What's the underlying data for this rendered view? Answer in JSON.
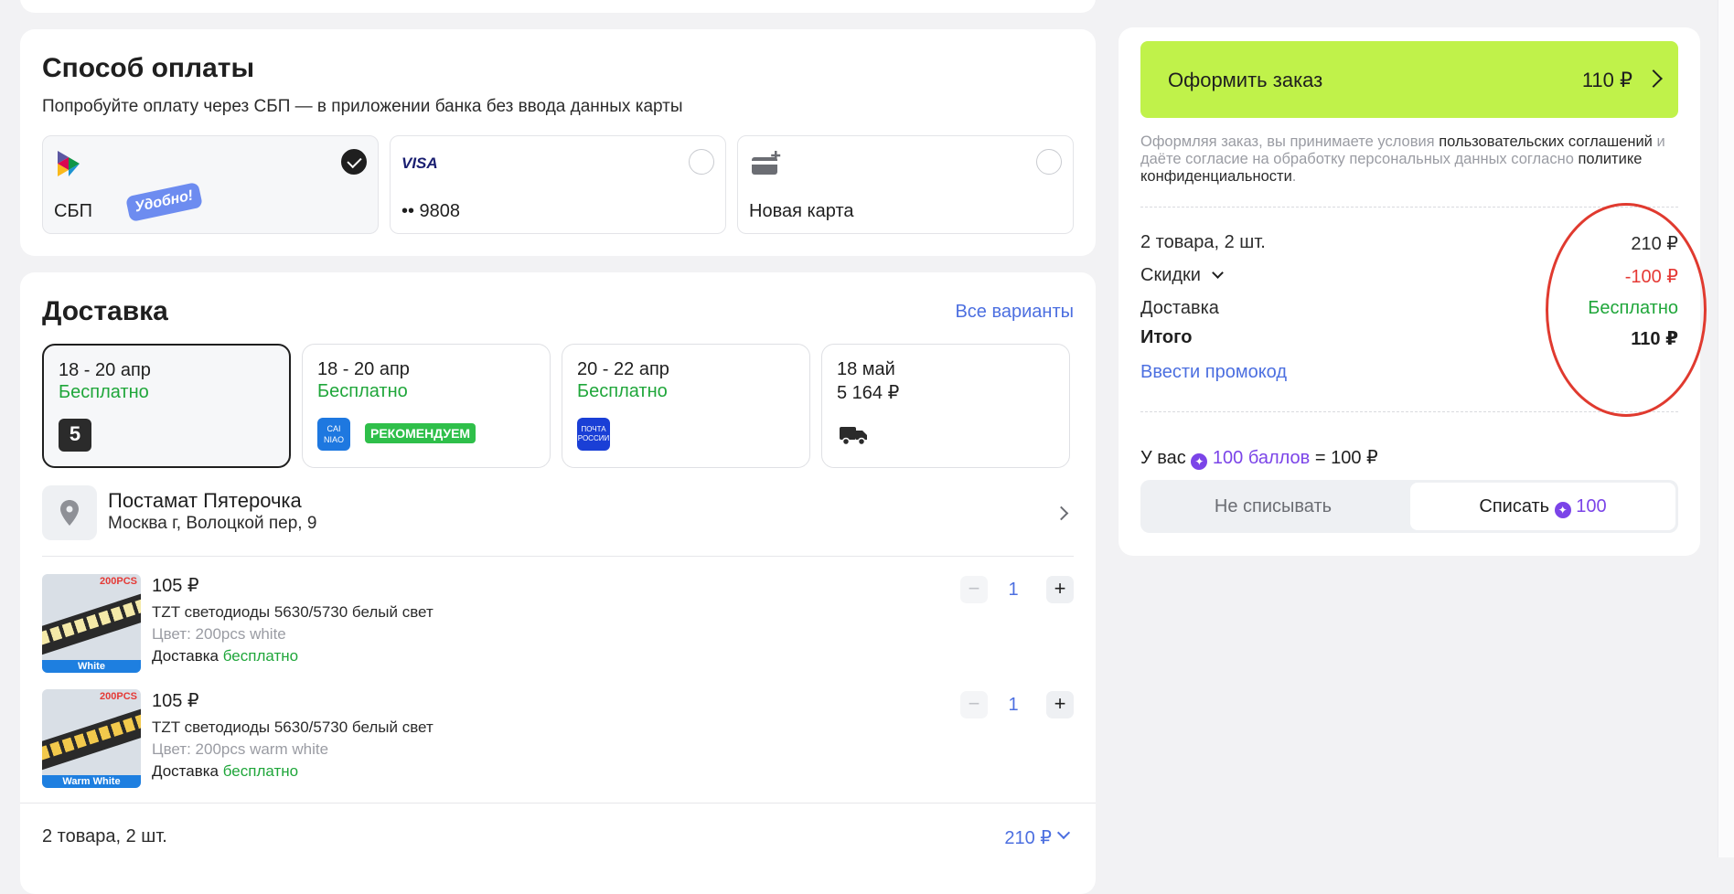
{
  "payment": {
    "title": "Способ оплаты",
    "subtitle": "Попробуйте оплату через СБП — в приложении банка без ввода данных карты",
    "options": [
      {
        "label": "СБП",
        "badge": "Удобно!",
        "selected": true
      },
      {
        "label": "•• 9808",
        "brand": "VISA",
        "selected": false
      },
      {
        "label": "Новая карта",
        "selected": false
      }
    ]
  },
  "delivery": {
    "title": "Доставка",
    "all_variants": "Все варианты",
    "options": [
      {
        "dates": "18 - 20 апр",
        "price": "Бесплатно",
        "carrier_icon": "pyaterochka-icon"
      },
      {
        "dates": "18 - 20 апр",
        "price": "Бесплатно",
        "carrier_icon": "cainiao-icon",
        "tag": "РЕКОМЕНДУЕМ"
      },
      {
        "dates": "20 - 22 апр",
        "price": "Бесплатно",
        "carrier_icon": "pochta-rossii-icon"
      },
      {
        "dates": "18 май",
        "price": "5 164 ₽",
        "carrier_icon": "truck-icon"
      }
    ],
    "pickup": {
      "name": "Постамат Пятерочка",
      "address": "Москва г, Волоцкой пер, 9"
    },
    "products": [
      {
        "price": "105 ₽",
        "name": "TZT светодиоды 5630/5730 белый свет",
        "color": "Цвет: 200pcs white",
        "ship_prefix": "Доставка",
        "ship_value": "бесплатно",
        "qty": "1",
        "thumb_pcs": "200PCS",
        "thumb_band": "White"
      },
      {
        "price": "105 ₽",
        "name": "TZT светодиоды 5630/5730 белый свет",
        "color": "Цвет: 200pcs warm white",
        "ship_prefix": "Доставка",
        "ship_value": "бесплатно",
        "qty": "1",
        "thumb_pcs": "200PCS",
        "thumb_band": "Warm White"
      }
    ],
    "footer_count": "2 товара, 2 шт.",
    "footer_total": "210 ₽"
  },
  "summary": {
    "order_button": "Оформить заказ",
    "order_price": "110 ₽",
    "terms_1": "Оформляя заказ, вы принимаете условия ",
    "terms_link1": "пользовательских соглашений",
    "terms_2": " и даёте согласие на обработку персональных данных согласно ",
    "terms_link2": "политике конфиденциальности",
    "terms_3": ".",
    "items_label": "2 товара, 2 шт.",
    "items_value": "210 ₽",
    "discount_label": "Скидки",
    "discount_value": "-100 ₽",
    "delivery_label": "Доставка",
    "delivery_value": "Бесплатно",
    "total_label": "Итого",
    "total_value": "110 ₽",
    "promo": "Ввести промокод",
    "points_prefix": "У вас",
    "points_value": "100 баллов",
    "points_eq": "= 100 ₽",
    "no_spend": "Не списывать",
    "spend": "Списать",
    "spend_value": "100"
  },
  "colors": {
    "accent_green": "#c0f24a",
    "link": "#4c6fe0",
    "free": "#1fa63a",
    "discount": "#e53935",
    "points": "#7b44e8"
  }
}
